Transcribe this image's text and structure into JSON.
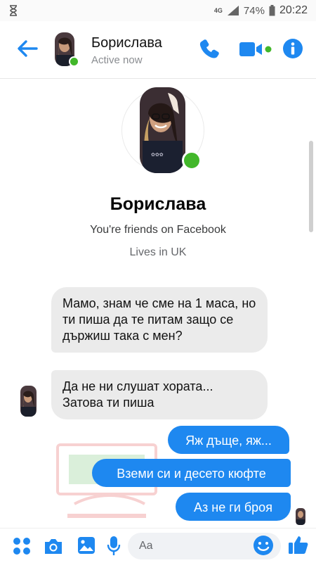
{
  "status_bar": {
    "network": "4G",
    "battery": "74%",
    "time": "20:22"
  },
  "header": {
    "name": "Борислава",
    "status": "Active now"
  },
  "profile": {
    "name": "Борислава",
    "line1": "You're friends on Facebook",
    "line2": "Lives in UK"
  },
  "messages": {
    "incoming_1": "Мамо, знам че сме на 1 маса, но ти пиша да те питам защо се държиш така с мен?",
    "incoming_2": "Да не ни слушат хората... Затова ти пиша",
    "outgoing_1": "Яж дъще, яж...",
    "outgoing_2": "Вземи си и десето кюфте",
    "outgoing_3": "Аз не ги броя"
  },
  "composer": {
    "placeholder": "Aa"
  },
  "colors": {
    "accent": "#1e88f0",
    "online": "#42b72a",
    "incoming_bubble": "#ebebeb"
  },
  "icons": [
    "hourglass-icon",
    "signal-icon",
    "battery-icon",
    "back-arrow-icon",
    "phone-icon",
    "video-icon",
    "info-icon",
    "apps-icon",
    "camera-icon",
    "gallery-icon",
    "mic-icon",
    "emoji-icon",
    "like-icon"
  ]
}
